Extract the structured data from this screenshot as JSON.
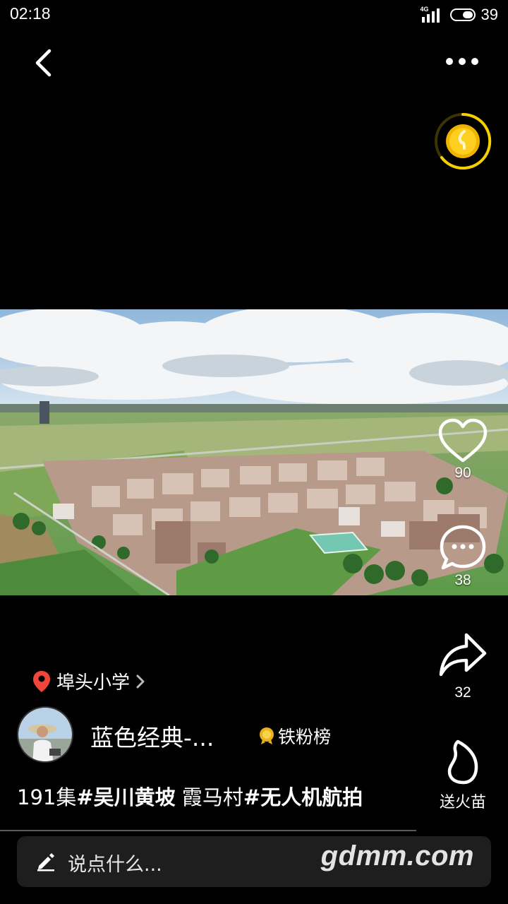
{
  "status_bar": {
    "time": "02:18",
    "network": "4G",
    "battery": "39"
  },
  "nav": {
    "back_icon": "chevron-left-icon",
    "more_icon": "more-horizontal-icon"
  },
  "coin": {
    "icon": "gold-coin-icon",
    "colors": {
      "ring": "#f5d000",
      "coin": "#f0b400"
    }
  },
  "actions": {
    "like": {
      "icon": "heart-icon",
      "count": "90"
    },
    "comment": {
      "icon": "comment-icon",
      "count": "38"
    },
    "share": {
      "icon": "share-icon",
      "count": "32"
    },
    "gift": {
      "icon": "flame-icon",
      "label": "送火苗"
    }
  },
  "location": {
    "icon": "location-pin-icon",
    "text": "埠头小学",
    "colors": {
      "pin": "#f0453a"
    }
  },
  "author": {
    "name": "蓝色经典-...",
    "badge_label": "铁粉榜",
    "badge_icon": "medal-icon"
  },
  "caption": {
    "prefix": "191集",
    "tag1": "#吴川黄坡",
    "middle": " 霞马村",
    "tag2": "#无人机航拍"
  },
  "comment_input": {
    "icon": "pencil-icon",
    "placeholder": "说点什么...",
    "watermark": "gdmm.com"
  }
}
